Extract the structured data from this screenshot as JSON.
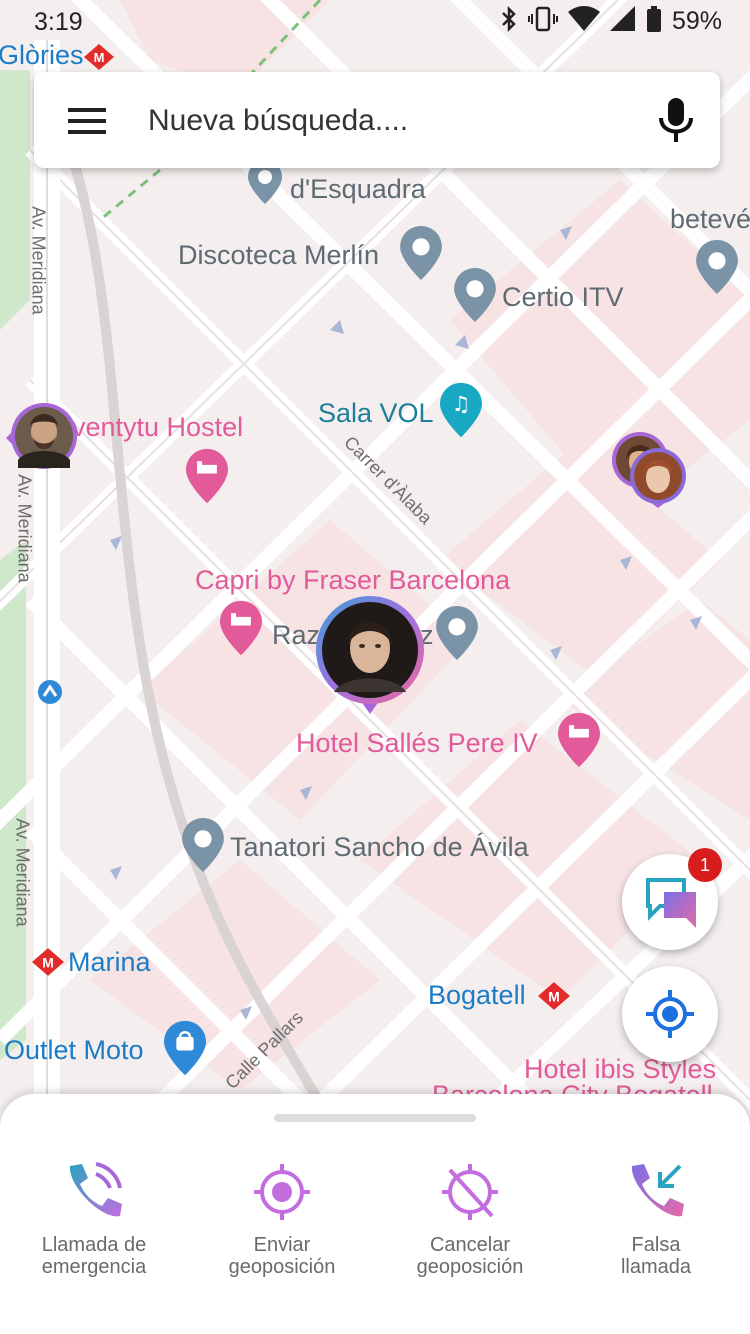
{
  "status_bar": {
    "time": "3:19",
    "battery": "59%"
  },
  "search": {
    "placeholder": "Nueva búsqueda...."
  },
  "map": {
    "labels": {
      "glories": "Glòries",
      "depot_line": "d'Esquadra",
      "discoteca": "Discoteca Merlín",
      "certio": "Certio ITV",
      "beteve": "betevé",
      "sala_vol": "Sala VOL",
      "hostel": "ventytu Hostel",
      "capri": "Capri by Fraser Barcelona",
      "razz": "Raz",
      "razz_end": "z",
      "hotel_salles": "Hotel Sallés Pere IV",
      "tanatori": "Tanatori Sancho de Ávila",
      "marina": "Marina",
      "bogatell": "Bogatell",
      "outlet": "Outlet Moto",
      "ibis": "Hotel ibis Styles",
      "ibis2": "Barcelona City Bogatell"
    },
    "streets": {
      "meridiana1": "Av. Meridiana",
      "meridiana2": "Av. Meridiana",
      "meridiana3": "Av. Meridiana",
      "alaba": "Carrer d'Àlaba",
      "pallars": "Calle Pallars"
    }
  },
  "fab": {
    "chat_badge": "1"
  },
  "actions": [
    {
      "label": "Llamada de\nemergencia"
    },
    {
      "label": "Enviar\ngeoposición"
    },
    {
      "label": "Cancelar\ngeoposición"
    },
    {
      "label": "Falsa\nllamada"
    }
  ],
  "colors": {
    "accent_teal": "#2aa3c0",
    "accent_purple": "#a867d8",
    "accent_pink": "#e35a9b",
    "fab_blue": "#1e6fe0"
  }
}
